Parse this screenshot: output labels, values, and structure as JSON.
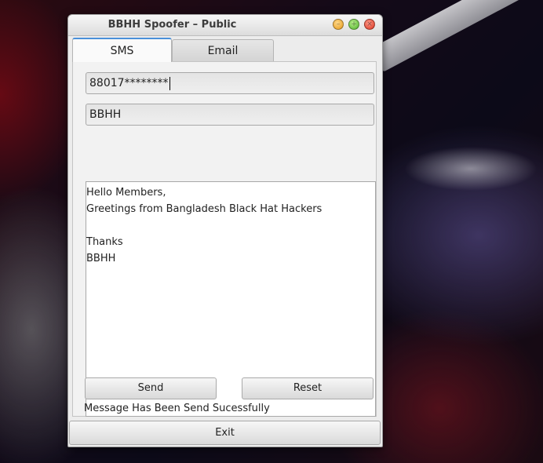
{
  "window": {
    "title": "BBHH Spoofer – Public"
  },
  "tabs": [
    {
      "label": "SMS",
      "active": true
    },
    {
      "label": "Email",
      "active": false
    }
  ],
  "sms_form": {
    "phone_value": "88017********",
    "sender_value": "BBHH",
    "message_lines": [
      "Hello Members,",
      "Greetings from Bangladesh Black Hat Hackers",
      "",
      "Thanks",
      "BBHH"
    ],
    "send_label": "Send",
    "reset_label": "Reset",
    "status_text": "Message Has Been Send Sucessfully"
  },
  "footer": {
    "exit_label": "Exit"
  },
  "icons": {
    "minimize": "minimize-icon",
    "maximize": "maximize-icon",
    "close": "close-icon"
  },
  "colors": {
    "tab_active_accent": "#4a90d9",
    "close_button": "#d9321e",
    "minimize_button": "#e59a1a",
    "maximize_button": "#4fb12b"
  }
}
